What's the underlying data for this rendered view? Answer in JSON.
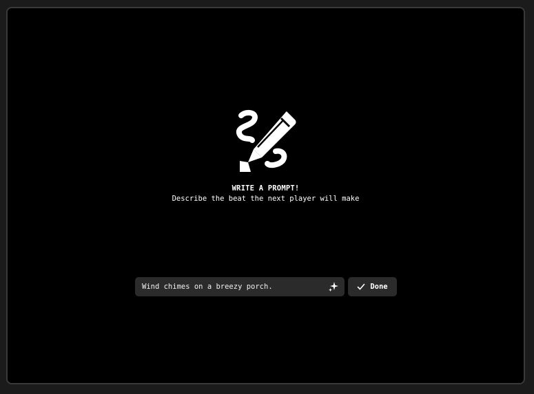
{
  "hero": {
    "icon": "pencil-squiggle-icon",
    "title": "WRITE A PROMPT!",
    "subtitle": "Describe the beat the next player will make"
  },
  "prompt": {
    "value": "Wind chimes on a breezy porch.",
    "assist_icon": "sparkle-icon"
  },
  "done_button": {
    "label": "Done",
    "icon": "check-icon"
  },
  "colors": {
    "background": "#000000",
    "frame_border": "#3a3a3a",
    "control_bg": "#2b2b2b",
    "text": "#ffffff"
  }
}
